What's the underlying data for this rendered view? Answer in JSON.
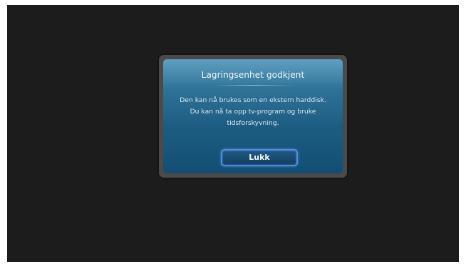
{
  "dialog": {
    "title": "Lagringsenhet godkjent",
    "message_lines": [
      "Den kan nå brukes som en ekstern harddisk.",
      "Du kan nå ta opp tv-program og bruke",
      "tidsforskyvning."
    ],
    "close_label": "Lukk"
  },
  "colors": {
    "screen_background": "#1c1c1c",
    "dialog_frame": "#4a4a4a",
    "dialog_background": "#2e7196",
    "button_focus_border": "#4d8de6"
  }
}
